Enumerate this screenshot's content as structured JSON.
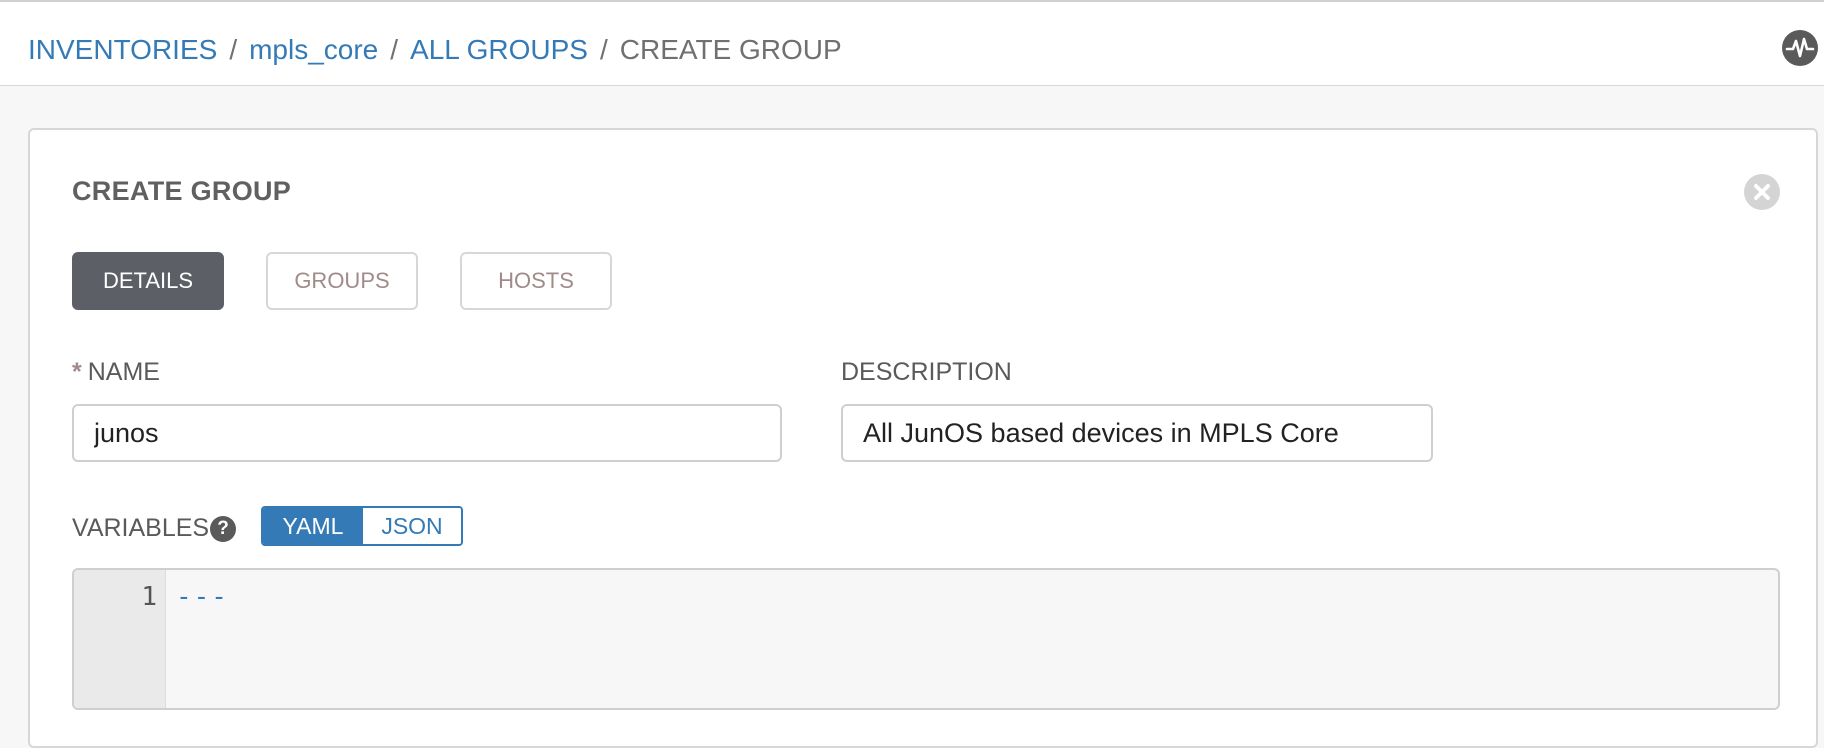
{
  "breadcrumb": {
    "items": [
      "INVENTORIES",
      "mpls_core",
      "ALL GROUPS"
    ],
    "separator": "/",
    "current": "CREATE GROUP"
  },
  "header": {
    "activity_icon": "activity-stream-icon"
  },
  "panel": {
    "title": "CREATE GROUP",
    "close_icon": "close-icon"
  },
  "tabs": [
    {
      "label": "DETAILS",
      "active": true
    },
    {
      "label": "GROUPS",
      "active": false
    },
    {
      "label": "HOSTS",
      "active": false
    }
  ],
  "form": {
    "name": {
      "label": "NAME",
      "required_marker": "*",
      "value": "junos"
    },
    "description": {
      "label": "DESCRIPTION",
      "value": "All JunOS based devices in MPLS Core"
    },
    "variables": {
      "label": "VARIABLES",
      "help_icon": "?",
      "formats": [
        "YAML",
        "JSON"
      ],
      "selected_format": "YAML",
      "editor": {
        "lines": [
          {
            "number": "1",
            "text": "---"
          }
        ]
      }
    }
  },
  "colors": {
    "link": "#337ab7",
    "active_tab": "#5c5f66",
    "inactive_tab_text": "#a18a8a",
    "required_star": "#a18a8a"
  }
}
